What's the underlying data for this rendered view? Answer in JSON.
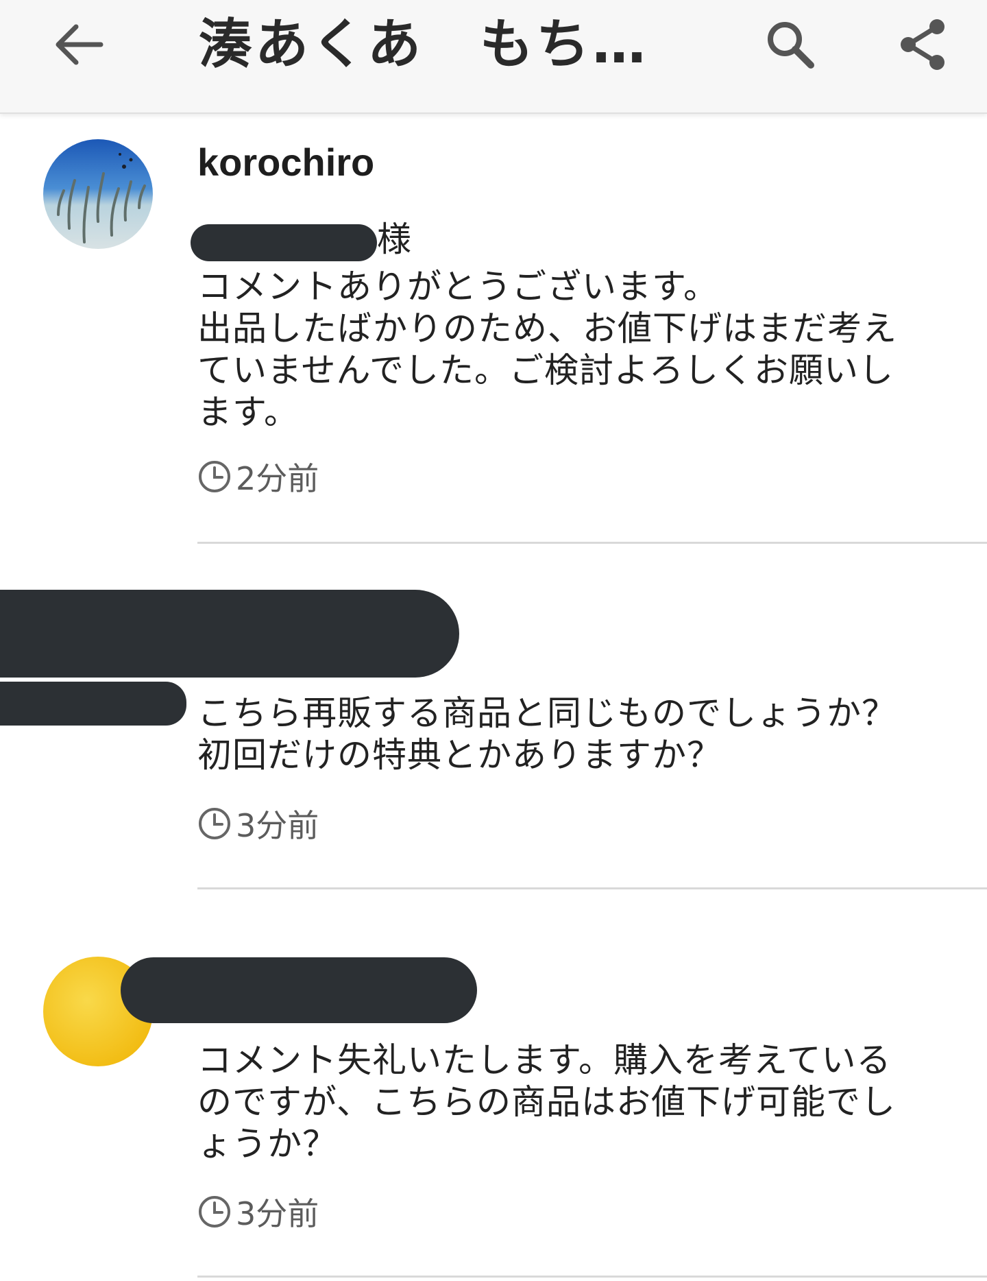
{
  "app_bar": {
    "back_icon": "arrow-left-icon",
    "title": "湊あくあ　もちど…",
    "search_icon": "search-icon",
    "share_icon": "share-icon"
  },
  "comments": [
    {
      "username": "korochiro",
      "avatar": "garden-eel-aquarium-photo",
      "addressee_suffix": "様",
      "body_lines": [
        "コメントありがとうございます。",
        "出品したばかりのため、お値下げはまだ考え",
        "ていませんでした。ご検討よろしくお願いし",
        "ます。"
      ],
      "time": "2分前"
    },
    {
      "username": "",
      "avatar": "",
      "body_lines": [
        "こちら再販する商品と同じものでしょうか？",
        "初回だけの特典とかありますか？"
      ],
      "time": "3分前"
    },
    {
      "username": "",
      "avatar": "yellow-circle-avatar",
      "body_lines": [
        "コメント失礼いたします。購入を考えている",
        "のですが、こちらの商品はお値下げ可能でし",
        "ょうか？"
      ],
      "time": "3分前"
    }
  ],
  "colors": {
    "app_bar_bg": "#f7f7f7",
    "text": "#222222",
    "meta_text": "#5c5c5c",
    "divider": "#d9d9d9",
    "redaction": "#2c3034",
    "avatar_yellow": "#f7c81e"
  }
}
